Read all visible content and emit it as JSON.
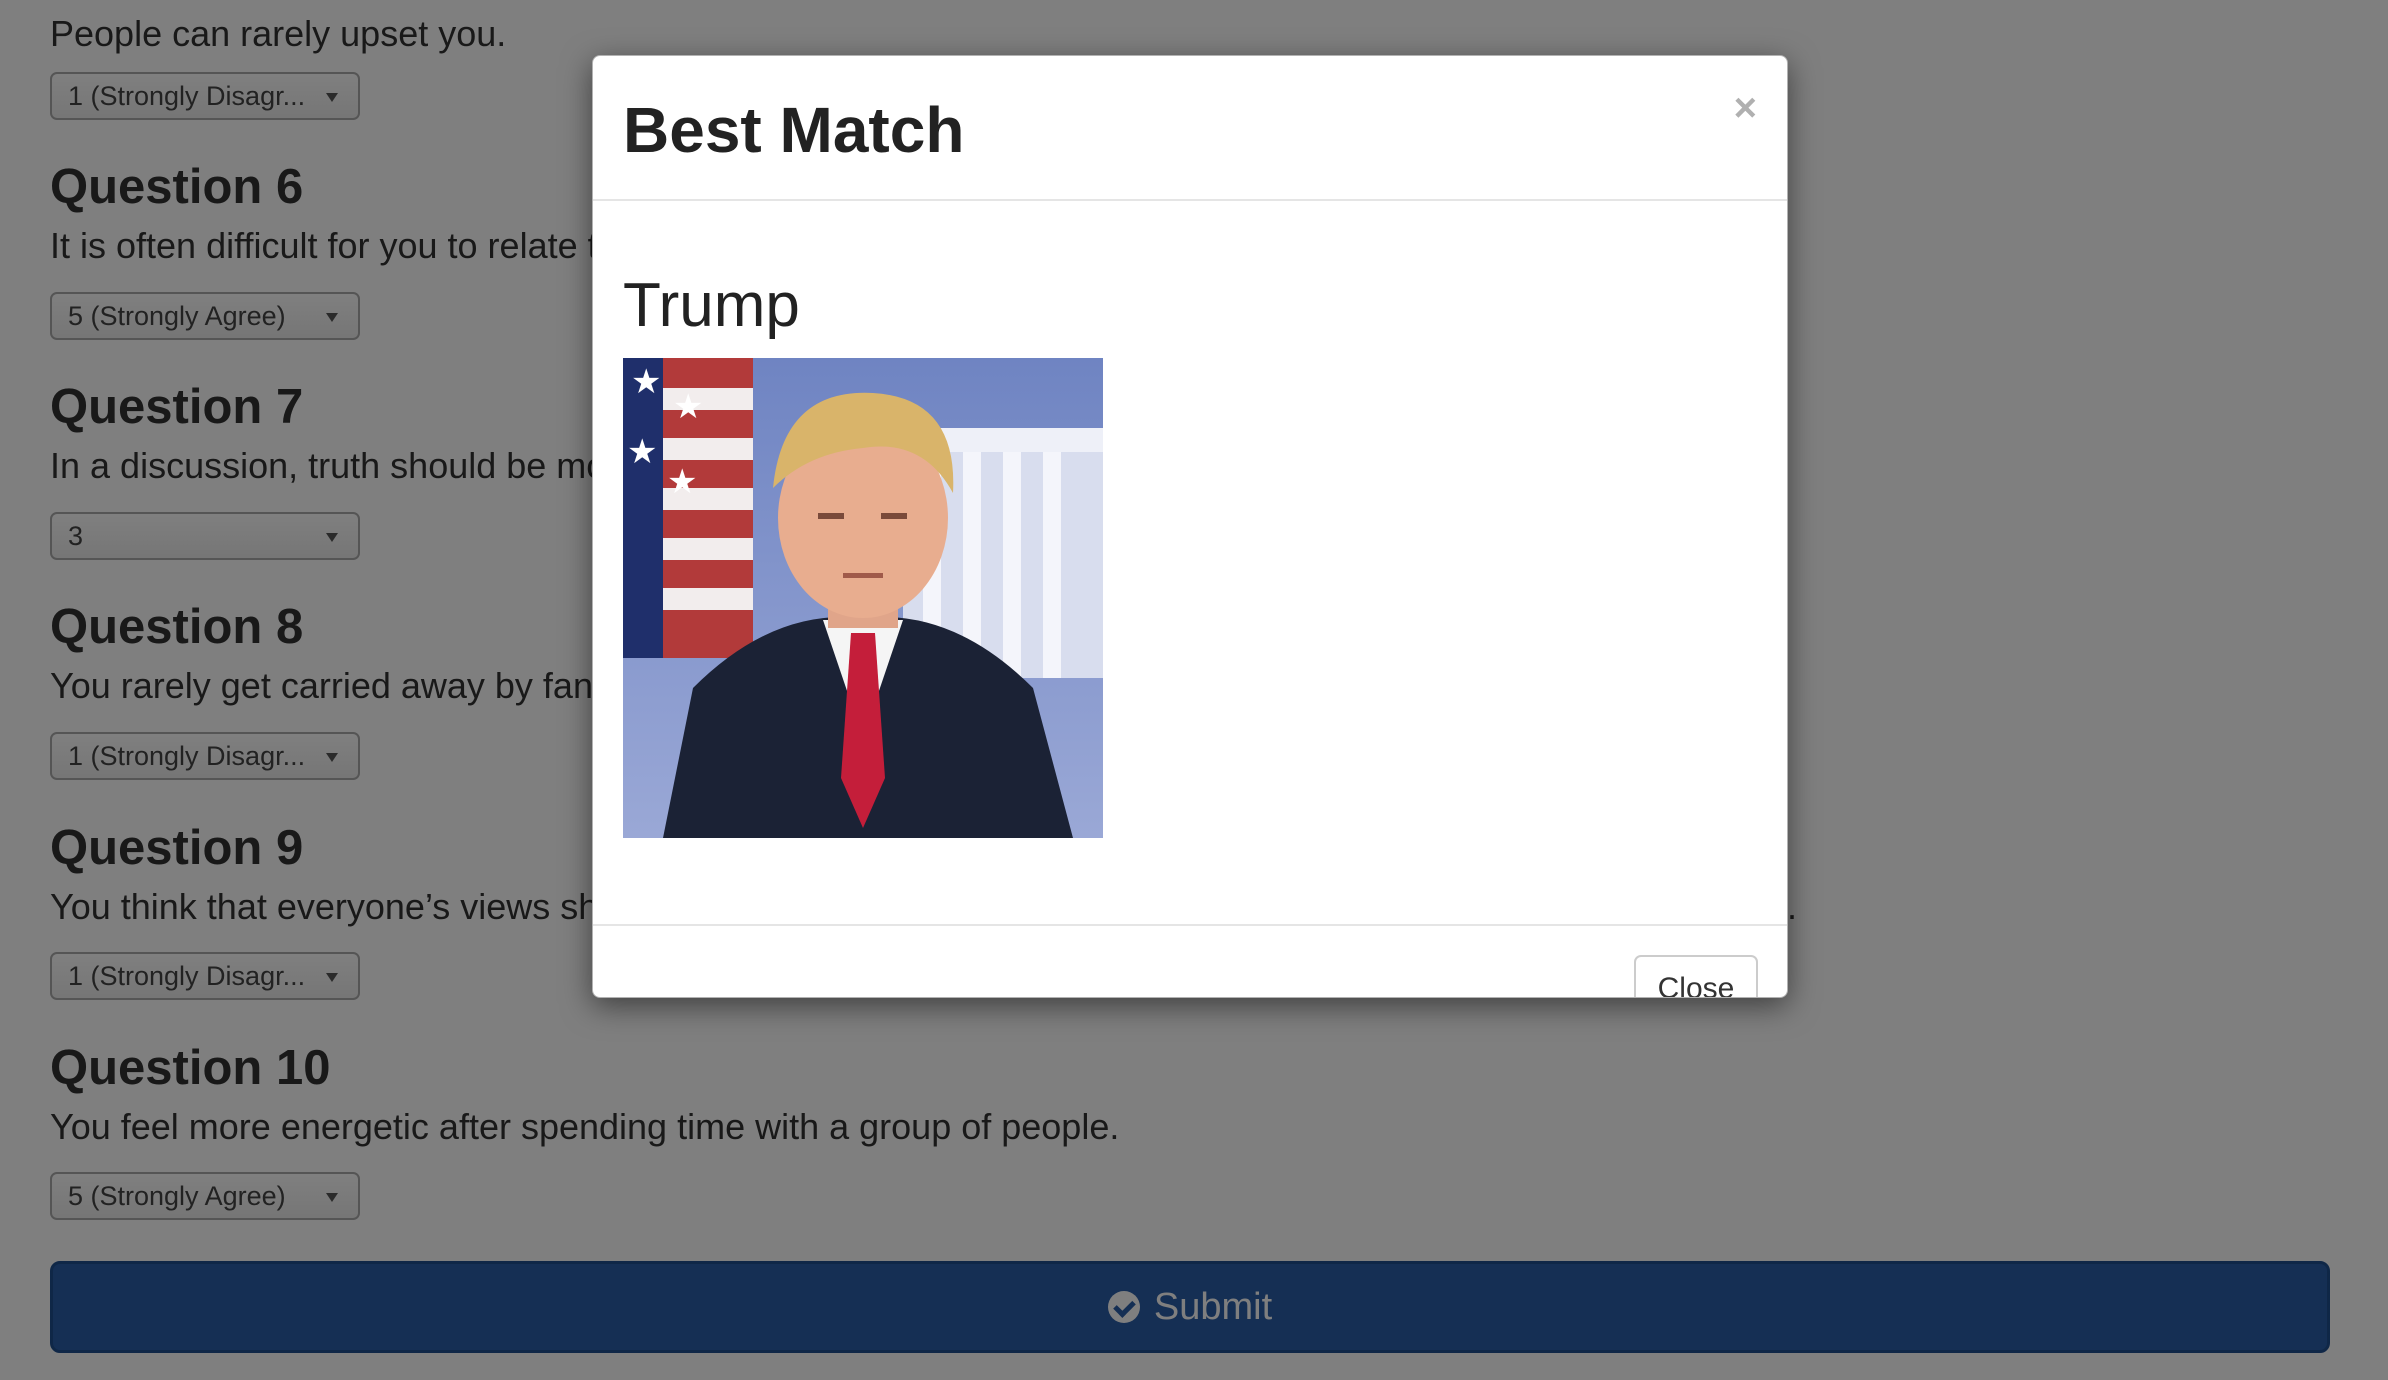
{
  "partial_question": {
    "text": "People can rarely upset you.",
    "selected": "1 (Strongly Disagr..."
  },
  "questions": [
    {
      "title": "Question 6",
      "text": "It is often difficult for you to relate to other people’s feelings.",
      "selected": "5 (Strongly Agree)"
    },
    {
      "title": "Question 7",
      "text": "In a discussion, truth should be more important than people’s sensitivities.",
      "selected": "3"
    },
    {
      "title": "Question 8",
      "text": "You rarely get carried away by fantasies and ideas.",
      "selected": "1 (Strongly Disagr..."
    },
    {
      "title": "Question 9",
      "text": "You think that everyone’s views should be respected regardless of whether they are supported by facts or not.",
      "selected": "1 (Strongly Disagr..."
    },
    {
      "title": "Question 10",
      "text": "You feel more energetic after spending time with a group of people.",
      "selected": "5 (Strongly Agree)"
    }
  ],
  "submit": {
    "label": "Submit",
    "icon": "check-circle-icon"
  },
  "modal": {
    "title": "Best Match",
    "close_symbol": "×",
    "match_name": "Trump",
    "close_button": "Close"
  },
  "colors": {
    "submit_bg": "#2a5ea9",
    "backdrop": "rgba(0,0,0,0.5)"
  }
}
